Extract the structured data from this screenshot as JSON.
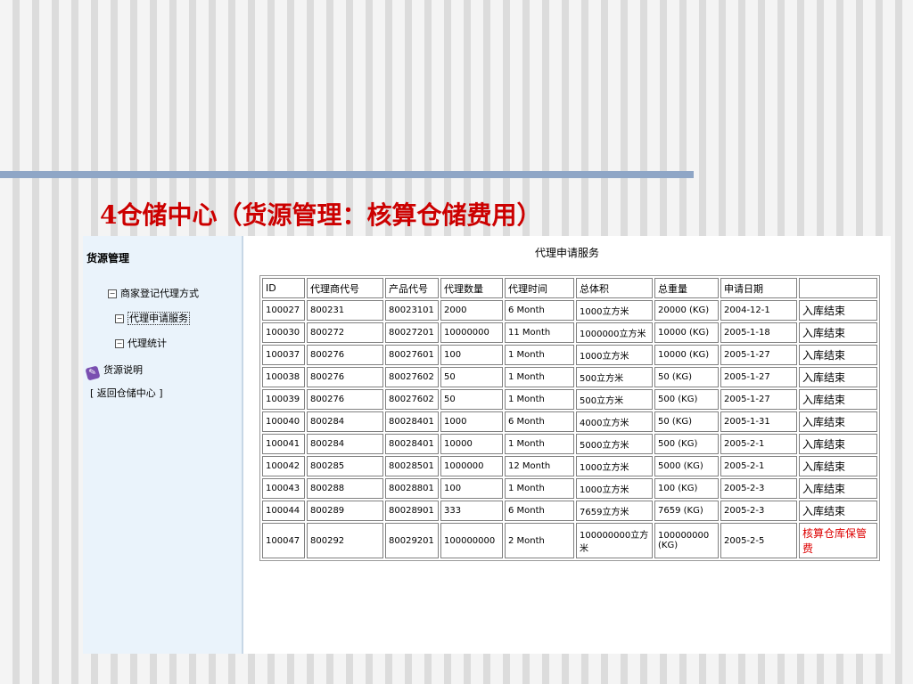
{
  "slide": {
    "title": "4仓储中心（货源管理：核算仓储费用）"
  },
  "sidebar": {
    "title": "货源管理",
    "tree": [
      {
        "label": "商家登记代理方式",
        "toggle": "−"
      },
      {
        "label": "代理申请服务",
        "toggle": "−"
      },
      {
        "label": "代理统计",
        "toggle": "−"
      }
    ],
    "info_label": "货源说明",
    "back_link": "[ 返回仓储中心 ]"
  },
  "panel": {
    "title": "代理申请服务"
  },
  "table": {
    "headers": [
      "ID",
      "代理商代号",
      "产品代号",
      "代理数量",
      "代理时间",
      "总体积",
      "总重量",
      "申请日期",
      ""
    ],
    "rows": [
      [
        "100027",
        "800231",
        "80023101",
        "2000",
        "6 Month",
        "1000立方米",
        "20000 (KG)",
        "2004-12-1",
        "入库结束"
      ],
      [
        "100030",
        "800272",
        "80027201",
        "10000000",
        "11 Month",
        "1000000立方米",
        "10000 (KG)",
        "2005-1-18",
        "入库结束"
      ],
      [
        "100037",
        "800276",
        "80027601",
        "100",
        "1 Month",
        "1000立方米",
        "10000 (KG)",
        "2005-1-27",
        "入库结束"
      ],
      [
        "100038",
        "800276",
        "80027602",
        "50",
        "1 Month",
        "500立方米",
        "50 (KG)",
        "2005-1-27",
        "入库结束"
      ],
      [
        "100039",
        "800276",
        "80027602",
        "50",
        "1 Month",
        "500立方米",
        "500 (KG)",
        "2005-1-27",
        "入库结束"
      ],
      [
        "100040",
        "800284",
        "80028401",
        "1000",
        "6 Month",
        "4000立方米",
        "50 (KG)",
        "2005-1-31",
        "入库结束"
      ],
      [
        "100041",
        "800284",
        "80028401",
        "10000",
        "1 Month",
        "5000立方米",
        "500 (KG)",
        "2005-2-1",
        "入库结束"
      ],
      [
        "100042",
        "800285",
        "80028501",
        "1000000",
        "12 Month",
        "1000立方米",
        "5000 (KG)",
        "2005-2-1",
        "入库结束"
      ],
      [
        "100043",
        "800288",
        "80028801",
        "100",
        "1 Month",
        "1000立方米",
        "100 (KG)",
        "2005-2-3",
        "入库结束"
      ],
      [
        "100044",
        "800289",
        "80028901",
        "333",
        "6 Month",
        "7659立方米",
        "7659 (KG)",
        "2005-2-3",
        "入库结束"
      ],
      [
        "100047",
        "800292",
        "80029201",
        "100000000",
        "2 Month",
        "100000000立方米",
        "100000000 (KG)",
        "2005-2-5",
        "核算仓库保管费"
      ]
    ]
  },
  "colors": {
    "title_red": "#cc0000",
    "alert_red": "#dd0000",
    "sidebar_bg": "#eaf3fb",
    "accent_bar": "#8fa6c6"
  },
  "icons": {
    "tree_toggle": "minus-box-icon",
    "info": "book-icon"
  }
}
